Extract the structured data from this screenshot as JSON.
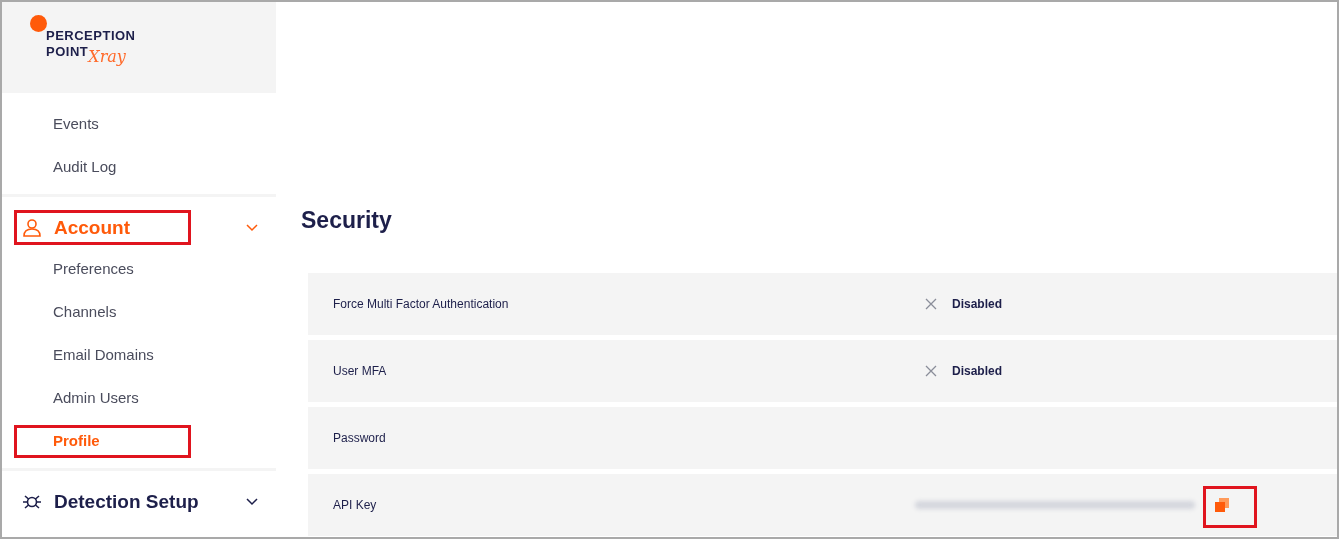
{
  "logo": {
    "line1": "PERCEPTION",
    "line2": "POINT",
    "script": "Xray"
  },
  "sidebar": {
    "top_items": [
      {
        "label": "Events",
        "selected": false
      },
      {
        "label": "Audit Log",
        "selected": false
      }
    ],
    "groups": [
      {
        "kind": "account",
        "label": "Account",
        "expanded": true,
        "active": true,
        "highlighted": true,
        "items": [
          {
            "label": "Preferences",
            "selected": false,
            "highlighted": false
          },
          {
            "label": "Channels",
            "selected": false,
            "highlighted": false
          },
          {
            "label": "Email Domains",
            "selected": false,
            "highlighted": false
          },
          {
            "label": "Admin Users",
            "selected": false,
            "highlighted": false
          },
          {
            "label": "Profile",
            "selected": true,
            "highlighted": true
          }
        ]
      },
      {
        "kind": "bug",
        "label": "Detection Setup",
        "expanded": false,
        "active": false,
        "highlighted": false
      }
    ]
  },
  "main": {
    "title": "Security",
    "rows": [
      {
        "kind": "status",
        "label": "Force Multi Factor Authentication",
        "status": "Disabled",
        "enabled": false
      },
      {
        "kind": "status",
        "label": "User MFA",
        "status": "Disabled",
        "enabled": false
      },
      {
        "kind": "empty",
        "label": "Password"
      },
      {
        "kind": "secret",
        "label": "API Key",
        "copy_highlighted": true
      }
    ]
  }
}
